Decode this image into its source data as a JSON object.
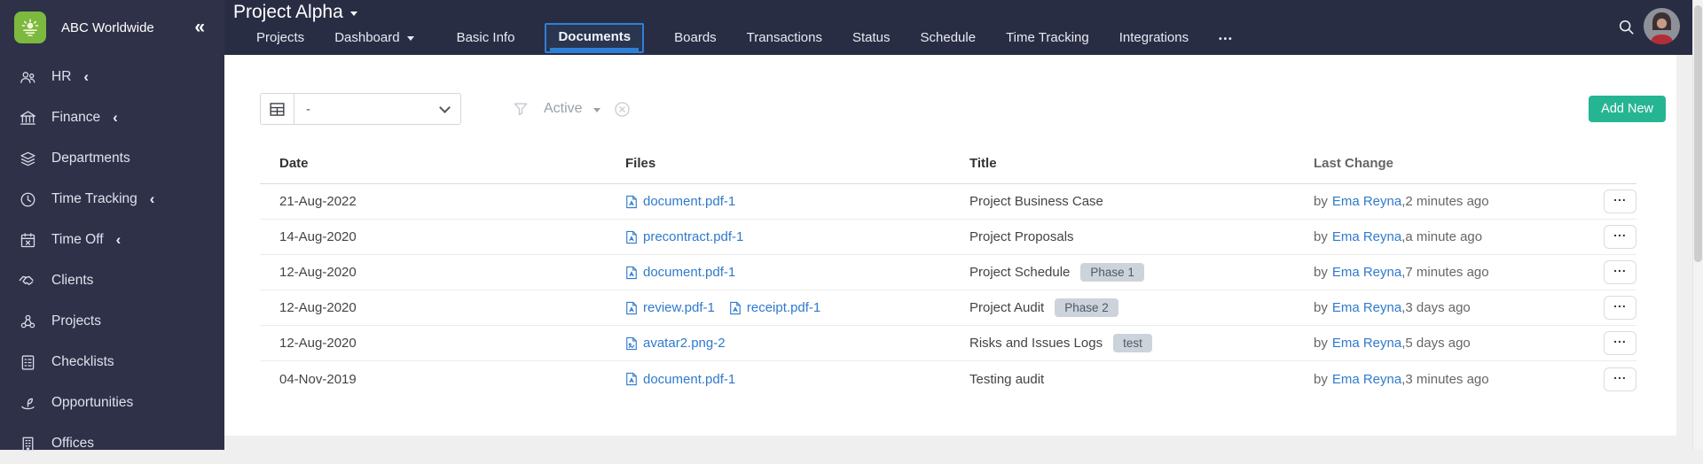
{
  "app": {
    "brand": "ABC Worldwide",
    "collapse_glyph": "«"
  },
  "sidebar": {
    "items": [
      {
        "label": "HR",
        "chevron": "‹"
      },
      {
        "label": "Finance",
        "chevron": "‹"
      },
      {
        "label": "Departments",
        "chevron": ""
      },
      {
        "label": "Time Tracking",
        "chevron": "‹"
      },
      {
        "label": "Time Off",
        "chevron": "‹"
      },
      {
        "label": "Clients",
        "chevron": ""
      },
      {
        "label": "Projects",
        "chevron": ""
      },
      {
        "label": "Checklists",
        "chevron": ""
      },
      {
        "label": "Opportunities",
        "chevron": ""
      },
      {
        "label": "Offices",
        "chevron": ""
      }
    ]
  },
  "header": {
    "project_title": "Project Alpha",
    "tabs": [
      {
        "label": "Projects"
      },
      {
        "label": "Dashboard"
      },
      {
        "label": "Basic Info"
      },
      {
        "label": "Documents",
        "active": true
      },
      {
        "label": "Boards"
      },
      {
        "label": "Transactions"
      },
      {
        "label": "Status"
      },
      {
        "label": "Schedule"
      },
      {
        "label": "Time Tracking"
      },
      {
        "label": "Integrations"
      },
      {
        "label": "•••"
      }
    ]
  },
  "toolbar": {
    "view_selector_value": "-",
    "filter_value": "Active",
    "add_button_label": "Add New"
  },
  "table": {
    "columns": {
      "date": "Date",
      "files": "Files",
      "title": "Title",
      "last_change": "Last Change"
    },
    "by_label": "by",
    "separator": " , ",
    "actions_glyph": "...",
    "rows": [
      {
        "date": "21-Aug-2022",
        "files": [
          {
            "name": "document.pdf-1",
            "kind": "pdf"
          }
        ],
        "title": "Project Business Case",
        "badge": "",
        "user": "Ema Reyna",
        "ago": "2 minutes ago"
      },
      {
        "date": "14-Aug-2020",
        "files": [
          {
            "name": "precontract.pdf-1",
            "kind": "pdf"
          }
        ],
        "title": "Project Proposals",
        "badge": "",
        "user": "Ema Reyna",
        "ago": "a minute ago"
      },
      {
        "date": "12-Aug-2020",
        "files": [
          {
            "name": "document.pdf-1",
            "kind": "pdf"
          }
        ],
        "title": "Project Schedule",
        "badge": "Phase 1",
        "user": "Ema Reyna",
        "ago": "7 minutes ago"
      },
      {
        "date": "12-Aug-2020",
        "files": [
          {
            "name": "review.pdf-1",
            "kind": "pdf"
          },
          {
            "name": "receipt.pdf-1",
            "kind": "pdf"
          }
        ],
        "title": "Project Audit",
        "badge": "Phase 2",
        "user": "Ema Reyna",
        "ago": "3 days ago"
      },
      {
        "date": "12-Aug-2020",
        "files": [
          {
            "name": "avatar2.png-2",
            "kind": "image"
          }
        ],
        "title": "Risks and Issues Logs",
        "badge": "test",
        "user": "Ema Reyna",
        "ago": "5 days ago"
      },
      {
        "date": "04-Nov-2019",
        "files": [
          {
            "name": "document.pdf-1",
            "kind": "pdf"
          }
        ],
        "title": "Testing audit",
        "badge": "",
        "user": "Ema Reyna",
        "ago": "3 minutes ago"
      }
    ]
  },
  "colors": {
    "sidebar_bg": "#2F3148",
    "header_bg": "#292D44",
    "accent_blue": "#2E80D7",
    "link_blue": "#2F7ACC",
    "add_green": "#26B592",
    "logo_green": "#7CB93E",
    "badge_bg": "#CDD3DB"
  }
}
